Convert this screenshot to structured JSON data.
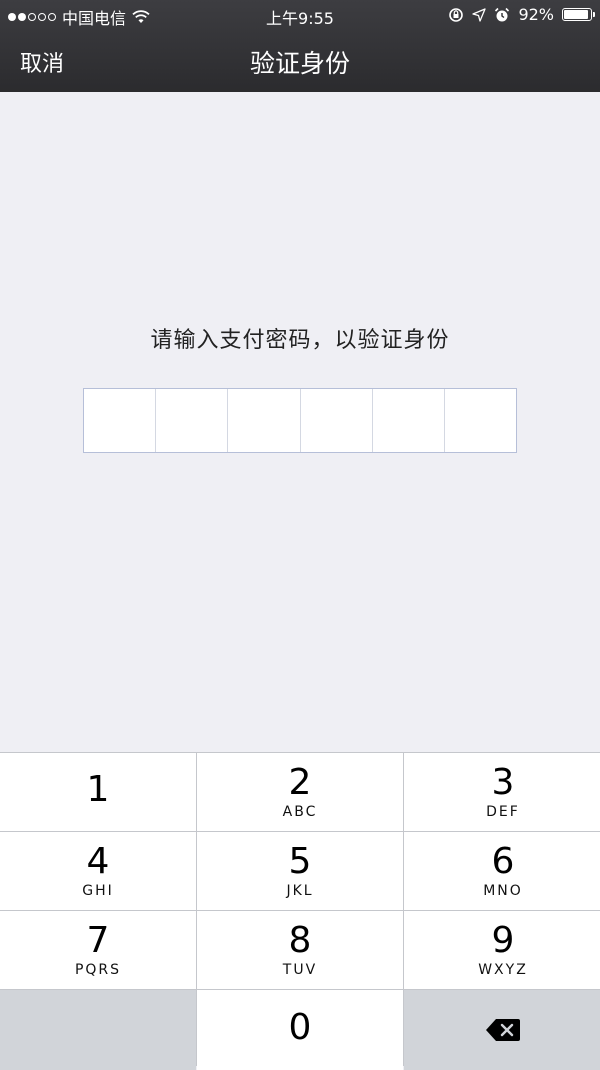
{
  "status_bar": {
    "signal_dots_filled": 2,
    "signal_dots_total": 5,
    "carrier": "中国电信",
    "time": "上午9:55",
    "battery_percent": "92%",
    "battery_level": 0.92
  },
  "nav": {
    "cancel_label": "取消",
    "title": "验证身份"
  },
  "prompt": "请输入支付密码，以验证身份",
  "pin_length": 6,
  "keypad": [
    {
      "num": "1",
      "letters": ""
    },
    {
      "num": "2",
      "letters": "ABC"
    },
    {
      "num": "3",
      "letters": "DEF"
    },
    {
      "num": "4",
      "letters": "GHI"
    },
    {
      "num": "5",
      "letters": "JKL"
    },
    {
      "num": "6",
      "letters": "MNO"
    },
    {
      "num": "7",
      "letters": "PQRS"
    },
    {
      "num": "8",
      "letters": "TUV"
    },
    {
      "num": "9",
      "letters": "WXYZ"
    },
    {
      "num": "0",
      "letters": ""
    }
  ],
  "colors": {
    "header_bg": "#2f2f32",
    "page_bg": "#efeff4",
    "pin_border": "#b6bfd8",
    "keypad_special_bg": "#d1d4d9"
  }
}
